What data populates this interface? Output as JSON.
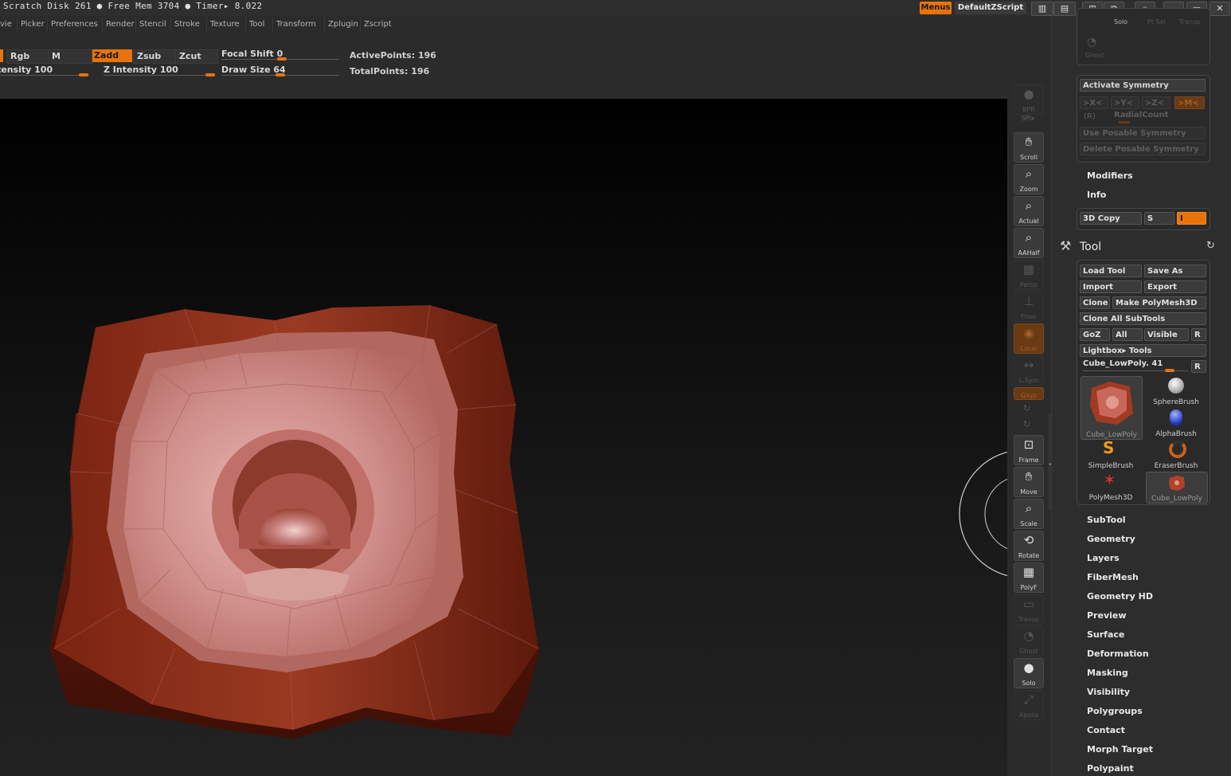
{
  "status": {
    "text": "Scratch Disk 261 ● Free Mem 3704 ● Timer▸ 8.022"
  },
  "header": {
    "menus_label": "Menus",
    "script_label": "DefaultZScript"
  },
  "menu": [
    "vie",
    "Picker",
    "Preferences",
    "Render",
    "Stencil",
    "Stroke",
    "Texture",
    "Tool",
    "Transform",
    "Zplugin",
    "Zscript"
  ],
  "brush": {
    "rgb": "Rgb",
    "m": "M",
    "zadd": "Zadd",
    "zsub": "Zsub",
    "zcut": "Zcut",
    "focal_shift_label": "Focal Shift",
    "focal_shift_value": "0",
    "intensity_label": "tensity",
    "intensity_value": "100",
    "z_intensity_label": "Z Intensity",
    "z_intensity_value": "100",
    "draw_size_label": "Draw Size",
    "draw_size_value": "64"
  },
  "stats": {
    "active_points": "ActivePoints: 196",
    "total_points": "TotalPoints: 196"
  },
  "shelf": [
    {
      "label": "BPR",
      "icon": "bpr-icon",
      "dim": true
    },
    {
      "label": "SPix",
      "icon": "spix-icon",
      "dim": true
    },
    {
      "label": "Scroll",
      "icon": "hand-icon",
      "dim": false
    },
    {
      "label": "Zoom",
      "icon": "zoom-icon",
      "dim": false
    },
    {
      "label": "Actual",
      "icon": "actual-icon",
      "dim": false
    },
    {
      "label": "AAHalf",
      "icon": "aahalf-icon",
      "dim": false
    },
    {
      "label": "Persp",
      "icon": "persp-icon",
      "dim": true
    },
    {
      "label": "Floor",
      "icon": "floor-icon",
      "dim": true
    },
    {
      "label": "Local",
      "icon": "local-icon",
      "dim": true
    },
    {
      "label": "L.Sym",
      "icon": "lsym-icon",
      "dim": true
    },
    {
      "label": "Qxyz",
      "icon": "xyz-icon",
      "dim": true
    },
    {
      "label": "Frame",
      "icon": "frame-icon",
      "dim": false
    },
    {
      "label": "Move",
      "icon": "move-icon",
      "dim": false
    },
    {
      "label": "Scale",
      "icon": "scale-icon",
      "dim": false
    },
    {
      "label": "Rotate",
      "icon": "rotate-icon",
      "dim": false
    },
    {
      "label": "PolyF",
      "icon": "polyf-icon",
      "dim": false
    },
    {
      "label": "Transp",
      "icon": "transp-icon",
      "dim": true
    },
    {
      "label": "Ghost",
      "icon": "ghost-icon",
      "dim": true
    },
    {
      "label": "Solo",
      "icon": "solo-icon",
      "dim": false
    },
    {
      "label": "Xpose",
      "icon": "xpose-icon",
      "dim": true
    }
  ],
  "tray": {
    "top_labels": {
      "solo": "Solo",
      "ptsel": "Pt Sel",
      "transp": "Transp",
      "ghost": "Ghost"
    },
    "symmetry": {
      "activate": "Activate Symmetry",
      "x": ">X<",
      "y": ">Y<",
      "z": ">Z<",
      "m": ">M<",
      "r": "(R)",
      "radial": "RadialCount",
      "use_posable": "Use Posable Symmetry",
      "delete_posable": "Delete Posable Symmetry"
    },
    "modifiers": "Modifiers",
    "info": "Info",
    "copy3d": "3D Copy",
    "s": "S",
    "i": "I",
    "tool_title": "Tool",
    "tool_buttons": {
      "load": "Load Tool",
      "save": "Save As",
      "import": "Import",
      "export": "Export",
      "clone": "Clone",
      "make_polymesh": "Make PolyMesh3D",
      "clone_all": "Clone All SubTools",
      "goz": "GoZ",
      "all": "All",
      "visible": "Visible",
      "r": "R",
      "lightbox": "Lightbox▸ Tools",
      "current_tool": "Cube_LowPoly. 41",
      "r2": "R"
    },
    "thumbs": [
      "Cube_LowPoly",
      "SphereBrush",
      "AlphaBrush",
      "SimpleBrush",
      "EraserBrush",
      "PolyMesh3D",
      "Cube_LowPoly"
    ],
    "sections": [
      "SubTool",
      "Geometry",
      "Layers",
      "FiberMesh",
      "Geometry HD",
      "Preview",
      "Surface",
      "Deformation",
      "Masking",
      "Visibility",
      "Polygroups",
      "Contact",
      "Morph Target",
      "Polypaint"
    ]
  },
  "colors": {
    "accent": "#e8730c",
    "mesh_outer": "#8a2a16",
    "mesh_inner": "#c98a86"
  }
}
